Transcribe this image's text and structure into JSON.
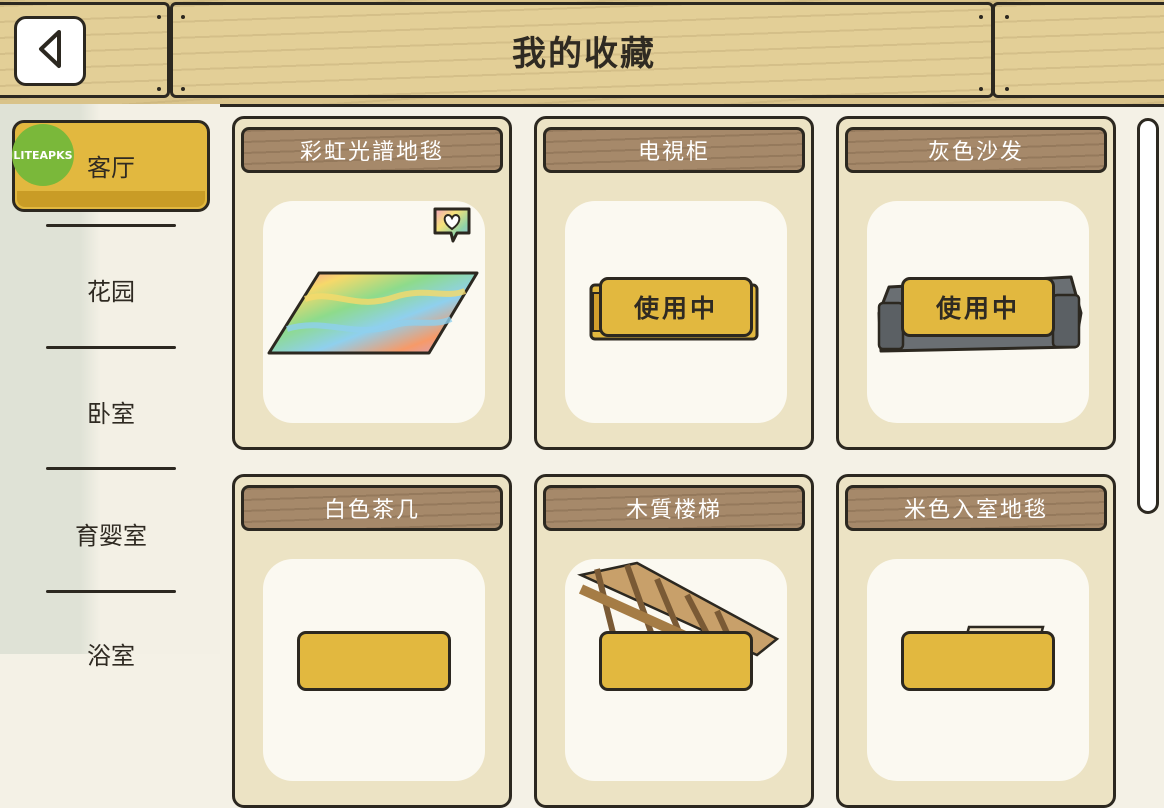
{
  "header": {
    "title": "我的收藏"
  },
  "sidebar": {
    "items": [
      {
        "label": "客厅"
      },
      {
        "label": "花园"
      },
      {
        "label": "卧室"
      },
      {
        "label": "育婴室"
      },
      {
        "label": "浴室"
      }
    ],
    "active": "客厅"
  },
  "watermark": "LITEAPKS",
  "cards": [
    {
      "label": "彩虹光譜地毯",
      "favorite": true
    },
    {
      "label": "电視柜",
      "status": "使用中"
    },
    {
      "label": "灰色沙发",
      "status": "使用中"
    },
    {
      "label": "白色茶几"
    },
    {
      "label": "木質楼梯"
    },
    {
      "label": "米色入室地毯"
    }
  ],
  "colors": {
    "accent": "#e2b83f",
    "wood_header": "#e3cf97",
    "label_wood": "#a6896a",
    "card_bg": "#ece3c4",
    "outline": "#2c2820"
  },
  "icons": [
    "back-arrow-icon",
    "heart-bubble-icon"
  ]
}
